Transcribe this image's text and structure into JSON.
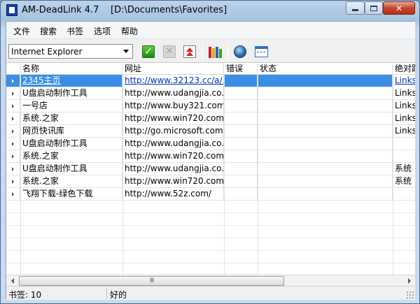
{
  "window": {
    "app_title": "AM-DeadLink 4.7",
    "path": "[D:\\Documents\\Favorites]",
    "min_glyph": "—",
    "close_glyph": "✕"
  },
  "menu": [
    "文件",
    "搜索",
    "书签",
    "选项",
    "帮助"
  ],
  "toolbar": {
    "browser_select": "Internet Explorer",
    "check_glyph": "✓",
    "cancel_glyph": "✕"
  },
  "columns": [
    "名称",
    "网址",
    "错误",
    "状态",
    "绝对路"
  ],
  "rows": [
    {
      "name": "2345主页",
      "url": "http://www.32123.cc/a/...",
      "error": "",
      "status": "",
      "path": "Links"
    },
    {
      "name": "U盘启动制作工具",
      "url": "http://www.udangjia.co...",
      "error": "",
      "status": "",
      "path": "Links"
    },
    {
      "name": "一号店",
      "url": "http://www.buy321.com...",
      "error": "",
      "status": "",
      "path": "Links"
    },
    {
      "name": "系统.之家",
      "url": "http://www.win720.com...",
      "error": "",
      "status": "",
      "path": "Links"
    },
    {
      "name": "网页快讯库",
      "url": "http://go.microsoft.com...",
      "error": "",
      "status": "",
      "path": "Links"
    },
    {
      "name": "U盘启动制作工具",
      "url": "http://www.udangjia.co...",
      "error": "",
      "status": "",
      "path": ""
    },
    {
      "name": "系统.之家",
      "url": "http://www.win720.com...",
      "error": "",
      "status": "",
      "path": ""
    },
    {
      "name": "U盘启动制作工具",
      "url": "http://www.udangjia.co...",
      "error": "",
      "status": "",
      "path": "系统"
    },
    {
      "name": "系统.之家",
      "url": "http://www.win720.com...",
      "error": "",
      "status": "",
      "path": "系统"
    },
    {
      "name": "飞翔下载-绿色下载",
      "url": "http://www.52z.com/",
      "error": "",
      "status": "",
      "path": ""
    }
  ],
  "selected_row": 0,
  "scrollbar": {
    "thumb_grip": "III"
  },
  "status": {
    "count": "书签: 10",
    "message": "好的"
  },
  "colors": {
    "selection": "#3b8ee6",
    "link": "#0030c0",
    "check_green": "#1f8a10",
    "up_red": "#d9201e"
  },
  "icons": [
    "app-icon",
    "check-icon",
    "cancel-icon",
    "move-up-icon",
    "books-icon",
    "globe-icon",
    "window-icon"
  ]
}
